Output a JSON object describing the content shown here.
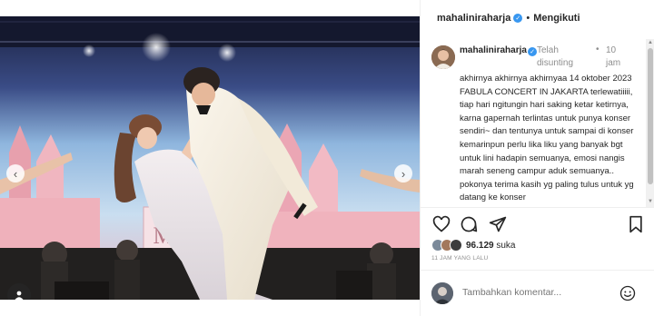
{
  "post": {
    "username": "mahaliniraharja",
    "separator": "•",
    "follow_label": "Mengikuti"
  },
  "caption": {
    "username": "mahaliniraharja",
    "edited_label": "Telah disunting",
    "bullet": "•",
    "time": "10 jam",
    "text": "akhirnya akhirnya akhirnyaa 14 oktober 2023 FABULA CONCERT IN JAKARTA terlewatiiiii, tiap hari ngitungin hari saking ketar ketirnya, karna gapernah terlintas untuk punya konser sendiri~ dan tentunya untuk sampai di konser kemarinpun perlu lika liku yang banyak bgt untuk lini hadapin semuanya, emosi nangis marah seneng campur aduk semuanya.. pokonya terima kasih yg paling tulus untuk yg datang ke konser"
  },
  "likes": {
    "count": "96.129",
    "suffix": "suka"
  },
  "timestamp": "11 JAM YANG LALU",
  "comment": {
    "placeholder": "Tambahkan komentar..."
  },
  "colors": {
    "accent": "#3897f0",
    "text": "#262626",
    "muted": "#8e8e8e",
    "divider": "#efefef"
  },
  "icons": {
    "like": "heart-icon",
    "comment": "comment-icon",
    "share": "share-icon",
    "save": "bookmark-icon",
    "emoji": "emoji-icon",
    "prev": "chevron-left-icon",
    "next": "chevron-right-icon",
    "tag": "user-tag-icon"
  },
  "carousel": {
    "total": 4,
    "active": 1
  }
}
